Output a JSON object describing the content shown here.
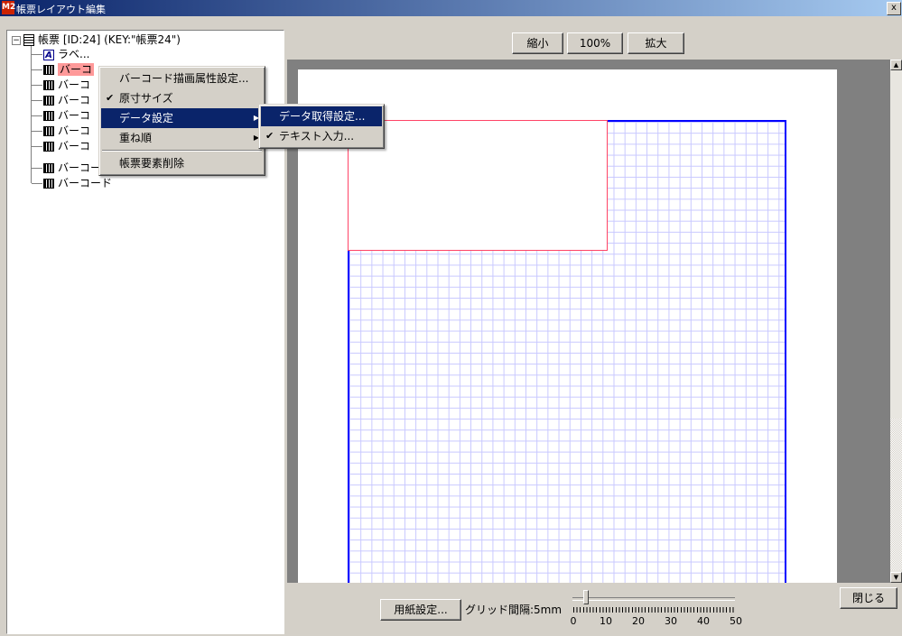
{
  "window": {
    "title": "帳票レイアウト編集",
    "app_icon": "M2",
    "close_glyph": "x"
  },
  "tree": {
    "root": "帳票 [ID:24] (KEY:\"帳票24\")",
    "expander": "−",
    "label_icon_glyph": "A",
    "items": [
      {
        "label": "ラベ..."
      },
      {
        "label": "バーコ"
      },
      {
        "label": "バーコ"
      },
      {
        "label": "バーコ"
      },
      {
        "label": "バーコ"
      },
      {
        "label": "バーコ"
      },
      {
        "label": "バーコ"
      },
      {
        "label": "バーコード"
      },
      {
        "label": "バーコード"
      }
    ]
  },
  "zoom": {
    "shrink": "縮小",
    "percent": "100%",
    "enlarge": "拡大"
  },
  "context_menu": {
    "items": [
      "バーコード描画属性設定...",
      "原寸サイズ",
      "データ設定",
      "重ね順",
      "帳票要素削除"
    ],
    "check": "✔",
    "arrow": "▶"
  },
  "submenu": {
    "items": [
      "データ取得設定...",
      "テキスト入力..."
    ]
  },
  "bottom": {
    "paper_settings": "用紙設定...",
    "grid_interval_label": "グリッド間隔:5mm",
    "grid_interval_value": 5,
    "slider_ticks": [
      "0",
      "10",
      "20",
      "30",
      "40",
      "50"
    ],
    "close": "閉じる"
  },
  "scrollbar": {
    "up": "▲",
    "down": "▼"
  },
  "colors": {
    "selection": "#0a246a",
    "grid_border": "#0000ff",
    "barcode_border": "#ff4466",
    "grid_line": "#c8c8ff"
  }
}
